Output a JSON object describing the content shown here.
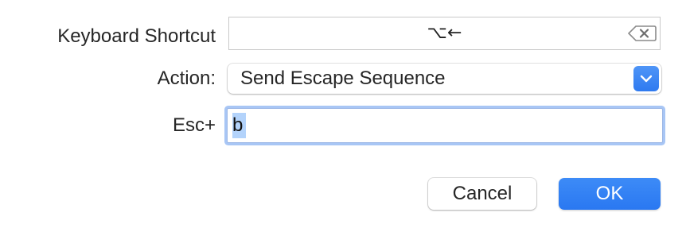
{
  "labels": {
    "keyboard_shortcut": "Keyboard Shortcut",
    "action": "Action:",
    "esc_plus": "Esc+"
  },
  "shortcut": {
    "value": "⌥←",
    "clear_icon": "clear-shortcut-icon"
  },
  "action_popup": {
    "selected": "Send Escape Sequence",
    "arrow_icon": "chevron-down-icon"
  },
  "esc_field": {
    "value": "b"
  },
  "buttons": {
    "cancel": "Cancel",
    "ok": "OK"
  },
  "colors": {
    "accent": "#2f7af0",
    "focus_ring": "#a8c6f5",
    "selection": "#b3d3fb"
  }
}
